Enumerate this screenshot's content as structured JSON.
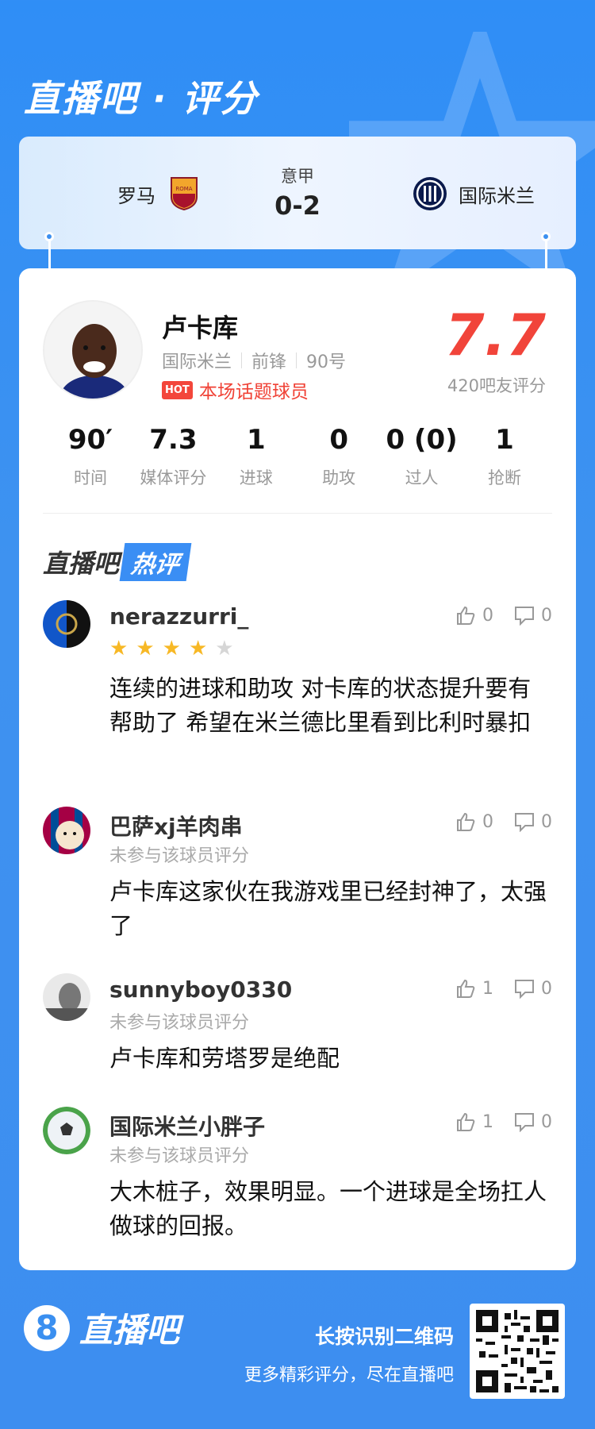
{
  "brand": {
    "title": "直播吧 · 评分"
  },
  "match": {
    "league": "意甲",
    "score": "0-2",
    "home": {
      "name": "罗马"
    },
    "away": {
      "name": "国际米兰"
    }
  },
  "player": {
    "name": "卢卡库",
    "team": "国际米兰",
    "position": "前锋",
    "number": "90号",
    "hot_badge": "HOT",
    "hot_label": "本场话题球员",
    "score": "7.7",
    "rating_count": "420吧友评分"
  },
  "stats": [
    {
      "value": "90′",
      "label": "时间"
    },
    {
      "value": "7.3",
      "label": "媒体评分"
    },
    {
      "value": "1",
      "label": "进球"
    },
    {
      "value": "0",
      "label": "助攻"
    },
    {
      "value": "0 (0)",
      "label": "过人"
    },
    {
      "value": "1",
      "label": "抢断"
    }
  ],
  "hot_section": {
    "brand": "直播吧",
    "tag": "热评"
  },
  "comments": [
    {
      "user": "nerazzurri_",
      "rating_stars": 4,
      "likes": "0",
      "replies": "0",
      "text": "连续的进球和助攻 对卡库的状态提升要有帮助了 希望在米兰德比里看到比利时暴扣"
    },
    {
      "user": "巴萨xj羊肉串",
      "sub": "未参与该球员评分",
      "likes": "0",
      "replies": "0",
      "text": "卢卡库这家伙在我游戏里已经封神了，太强了"
    },
    {
      "user": "sunnyboy0330",
      "sub": "未参与该球员评分",
      "likes": "1",
      "replies": "0",
      "text": "卢卡库和劳塔罗是绝配"
    },
    {
      "user": "国际米兰小胖子",
      "sub": "未参与该球员评分",
      "likes": "1",
      "replies": "0",
      "text": "大木桩子，效果明显。一个进球是全场扛人做球的回报。"
    }
  ],
  "footer": {
    "logo_digit": "8",
    "logo_text": "直播吧",
    "qr_hint": "长按识别二维码",
    "qr_sub": "更多精彩评分，尽在直播吧"
  },
  "colors": {
    "primary": "#3a8ff0",
    "score_red": "#f1443a",
    "star": "#f7b825"
  }
}
